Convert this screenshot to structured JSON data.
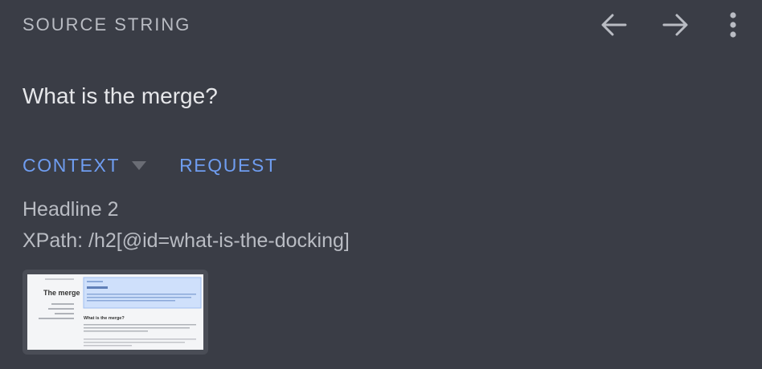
{
  "header": {
    "title": "SOURCE STRING",
    "back_icon": "arrow-left-icon",
    "forward_icon": "arrow-right-icon",
    "more_icon": "more-vertical-icon"
  },
  "source": {
    "text": "What is the merge?"
  },
  "tabs": [
    {
      "label": "CONTEXT",
      "has_dropdown": true
    },
    {
      "label": "REQUEST",
      "has_dropdown": false
    }
  ],
  "context": {
    "type": "Headline 2",
    "xpath": "XPath: /h2[@id=what-is-the-docking]"
  },
  "screenshot_thumbnail": {
    "heading": "The merge",
    "section_heading": "What is the merge?"
  },
  "colors": {
    "background": "#3a3d46",
    "accent": "#6f9df0",
    "text_primary": "#e6e7ea",
    "text_secondary": "#b9bcc3"
  }
}
